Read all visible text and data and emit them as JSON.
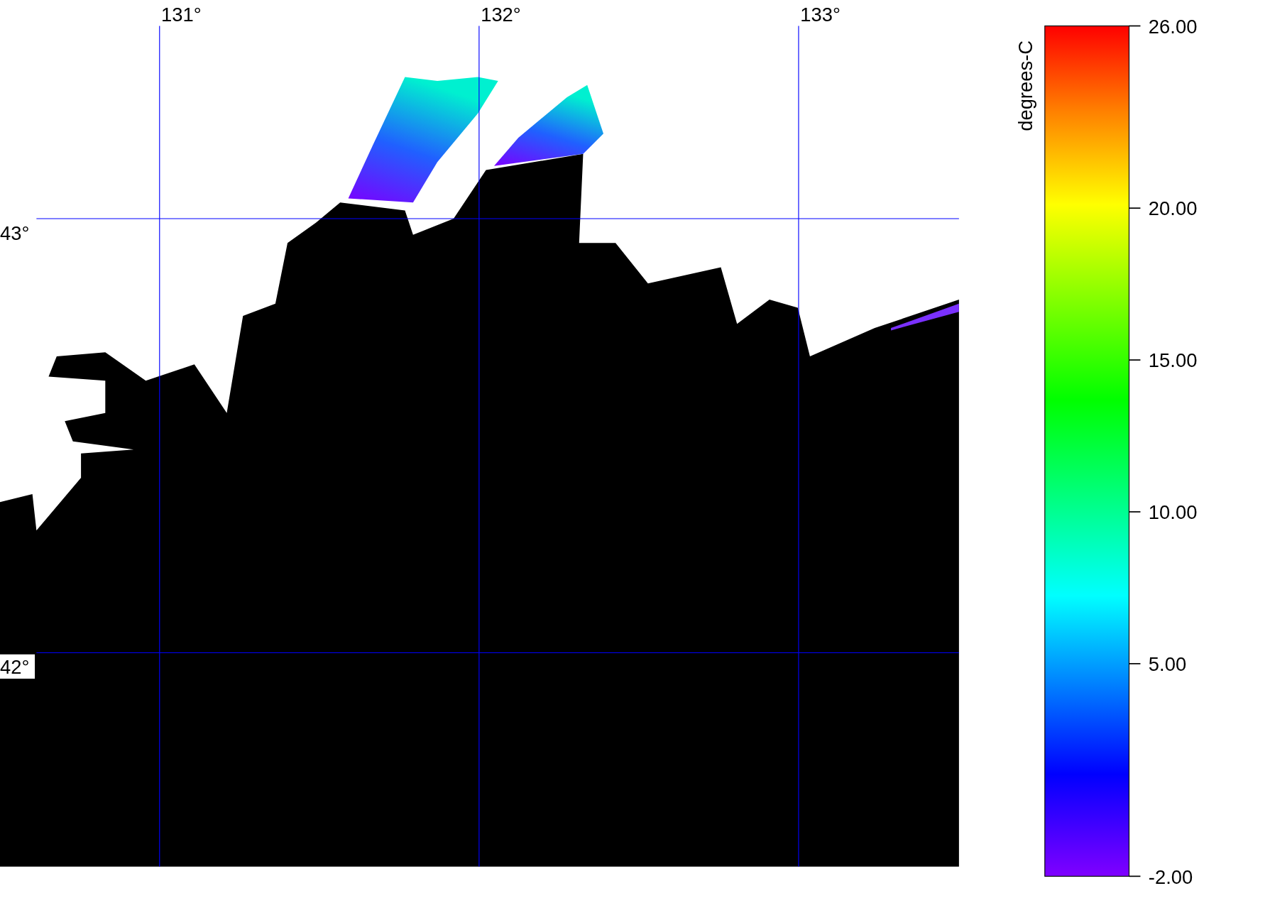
{
  "map": {
    "longitude_labels": [
      "131°",
      "132°",
      "133°"
    ],
    "latitude_labels": [
      "43°",
      "42°"
    ]
  },
  "color_scale": {
    "unit": "degrees-C",
    "ticks": [
      "26.00",
      "20.00",
      "15.00",
      "10.00",
      "5.00",
      "-2.00"
    ]
  }
}
